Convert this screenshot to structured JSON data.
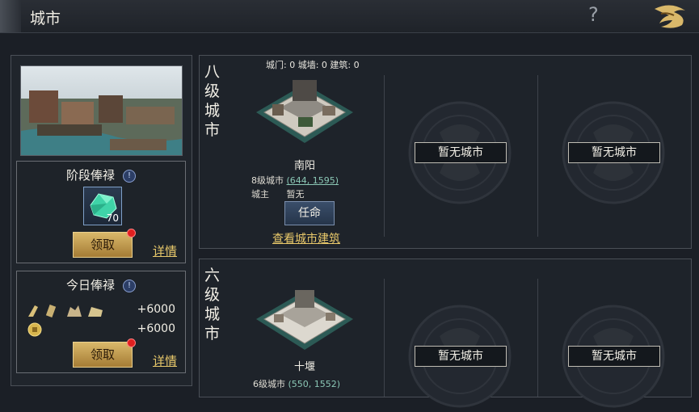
{
  "header": {
    "title": "城市",
    "help_icon": "?"
  },
  "left": {
    "stage_salary": {
      "title": "阶段俸禄",
      "gem_count": "70",
      "claim_label": "领取",
      "detail_label": "详情"
    },
    "daily_salary": {
      "title": "今日俸禄",
      "rows": [
        {
          "value": "+6000"
        },
        {
          "value": "+6000"
        }
      ],
      "claim_label": "领取",
      "detail_label": "详情"
    }
  },
  "groups": [
    {
      "level_label": "八级城市",
      "stats": "城门: 0  城墙: 0  建筑: 0",
      "city": {
        "name": "南阳",
        "level_text": "8级城市",
        "coords": "(644, 1595)",
        "owner_label": "城主",
        "owner_value": "暂无",
        "appoint_label": "任命",
        "view_label": "查看城市建筑"
      },
      "empty_slots": [
        "暂无城市",
        "暂无城市"
      ]
    },
    {
      "level_label": "六级城市",
      "city": {
        "name": "十堰",
        "level_text": "6级城市",
        "coords": "(550, 1552)"
      },
      "empty_slots": [
        "暂无城市",
        "暂无城市"
      ]
    }
  ]
}
